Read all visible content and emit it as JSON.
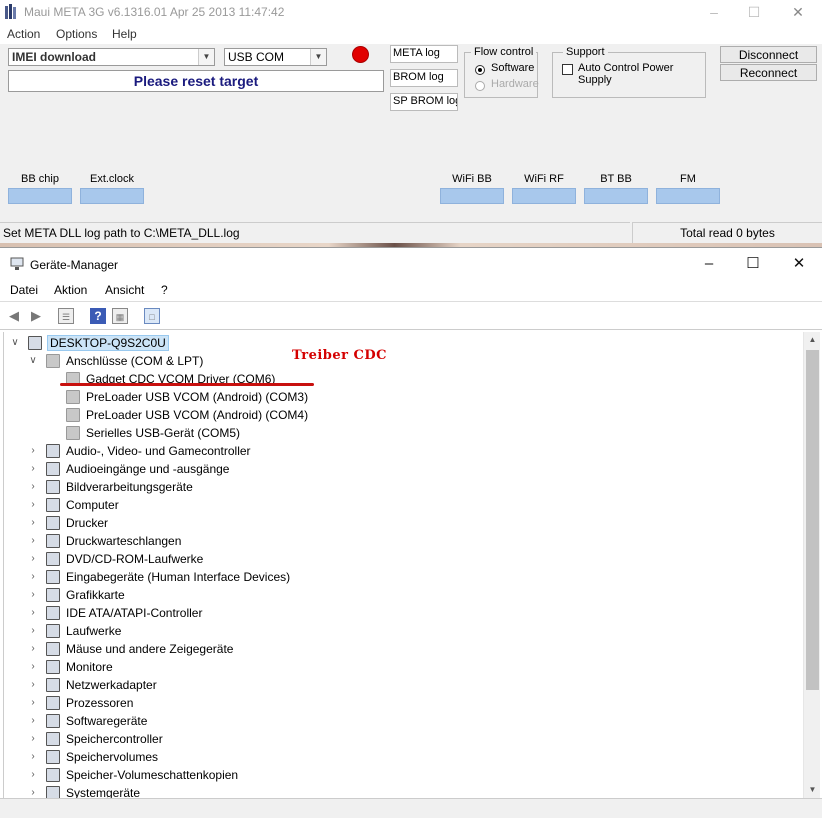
{
  "meta": {
    "title": "Maui META 3G v6.1316.01 Apr 25 2013 11:47:42",
    "win_controls": [
      "–",
      "☐",
      "✕"
    ],
    "menu": [
      "Action",
      "Options",
      "Help"
    ],
    "mode_select": "IMEI download",
    "port_select": "USB COM",
    "status_message": "Please reset target",
    "logs": [
      "META log",
      "BROM log",
      "SP BROM log"
    ],
    "flow_control": {
      "title": "Flow control",
      "software": "Software",
      "hardware": "Hardware",
      "selected": "Software"
    },
    "support": {
      "title": "Support",
      "auto_control": "Auto Control Power Supply",
      "checked": false
    },
    "buttons": {
      "disconnect": "Disconnect",
      "reconnect": "Reconnect"
    },
    "indicators": [
      "BB chip",
      "Ext.clock",
      "WiFi BB",
      "WiFi RF",
      "BT BB",
      "FM"
    ],
    "statusbar_left": "Set META DLL log path to C:\\META_DLL.log",
    "statusbar_right": "Total read 0 bytes",
    "connected_color": "#e10000"
  },
  "device_manager": {
    "title": "Geräte-Manager",
    "win_controls": [
      "–",
      "☐",
      "✕"
    ],
    "menu": [
      "Datei",
      "Aktion",
      "Ansicht",
      "?"
    ],
    "root": "DESKTOP-Q9S2C0U",
    "annotation": "Treiber CDC",
    "ports_category": "Anschlüsse (COM & LPT)",
    "ports": [
      "Gadget CDC VCOM Driver (COM6)",
      "PreLoader USB VCOM (Android) (COM3)",
      "PreLoader USB VCOM (Android) (COM4)",
      "Serielles USB-Gerät (COM5)"
    ],
    "categories": [
      "Audio-, Video- und Gamecontroller",
      "Audioeingänge und -ausgänge",
      "Bildverarbeitungsgeräte",
      "Computer",
      "Drucker",
      "Druckwarteschlangen",
      "DVD/CD-ROM-Laufwerke",
      "Eingabegeräte (Human Interface Devices)",
      "Grafikkarte",
      "IDE ATA/ATAPI-Controller",
      "Laufwerke",
      "Mäuse und andere Zeigegeräte",
      "Monitore",
      "Netzwerkadapter",
      "Prozessoren",
      "Softwaregeräte",
      "Speichercontroller",
      "Speichervolumes",
      "Speicher-Volumeschattenkopien",
      "Systemgeräte"
    ]
  }
}
